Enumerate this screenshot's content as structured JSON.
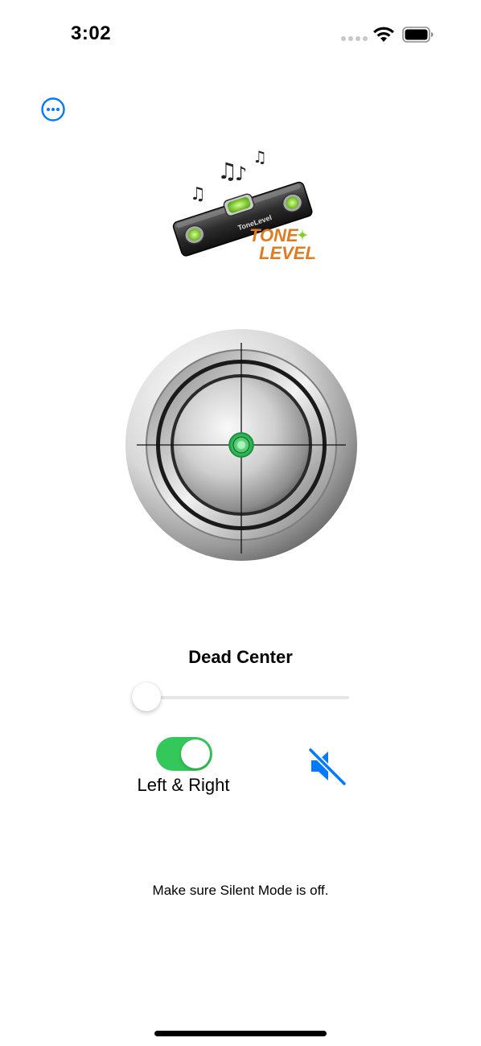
{
  "status_bar": {
    "time": "3:02",
    "wifi_icon": "wifi-icon",
    "battery_icon": "battery-icon"
  },
  "toolbar": {
    "more_icon": "ellipsis-circle-icon",
    "accent_color": "#007aff"
  },
  "logo": {
    "line1": "TONE",
    "line2": "LEVEL",
    "device_text": "ToneLevel",
    "text_color": "#e07b20",
    "bubble_color": "#7ed321"
  },
  "level": {
    "status_label": "Dead Center",
    "bubble_color": "#34c759"
  },
  "slider": {
    "value": 0.0
  },
  "toggle": {
    "label": "Left & Right",
    "on": true,
    "on_color": "#34c759"
  },
  "sound": {
    "icon": "speaker-slash-icon",
    "muted": true
  },
  "hint": {
    "text": "Make sure Silent Mode is off."
  }
}
